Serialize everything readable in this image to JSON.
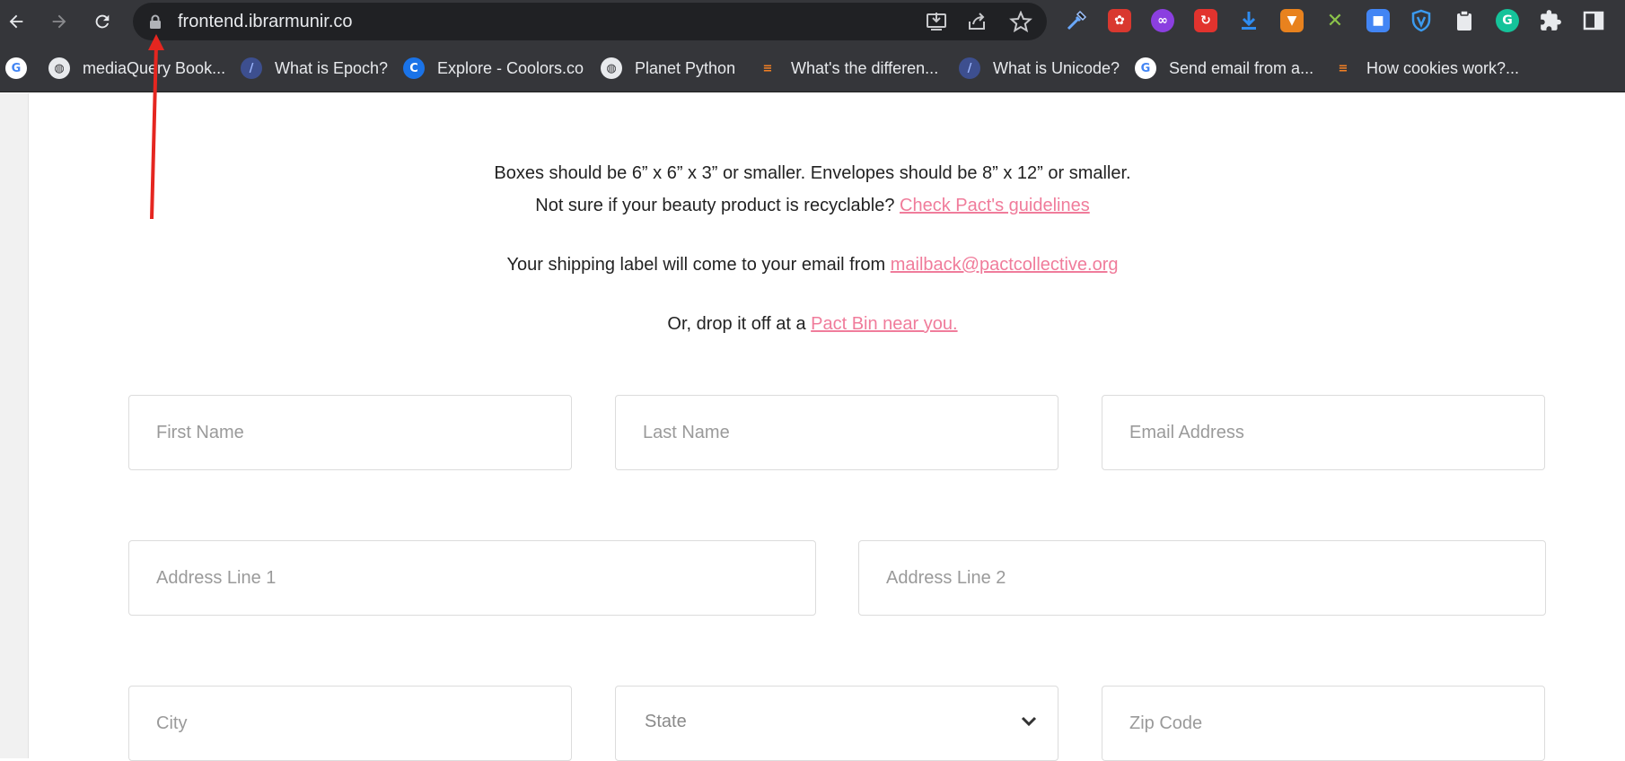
{
  "browser": {
    "url": "frontend.ibrarmunir.co",
    "bookmarks": [
      {
        "label": "",
        "icon": "google-icon"
      },
      {
        "label": "mediaQuery Book...",
        "icon": "globe-icon"
      },
      {
        "label": "What is Epoch?",
        "icon": "slash-icon"
      },
      {
        "label": "Explore - Coolors.co",
        "icon": "coolors-icon"
      },
      {
        "label": "Planet Python",
        "icon": "globe-icon"
      },
      {
        "label": "What's the differen...",
        "icon": "stackoverflow-icon"
      },
      {
        "label": "What is Unicode?",
        "icon": "slash-icon"
      },
      {
        "label": "Send email from a...",
        "icon": "google-icon"
      },
      {
        "label": "How cookies work?...",
        "icon": "stackoverflow-icon"
      }
    ]
  },
  "content": {
    "line1": "Boxes should be 6” x 6” x 3” or smaller. Envelopes should be 8” x 12” or smaller.",
    "line2_text": "Not sure if your beauty product is recyclable? ",
    "line2_link": "Check Pact's guidelines",
    "line3_text": "Your shipping label will come to your email from ",
    "line3_link": "mailback@pactcollective.org",
    "line4_text": "Or, drop it off at a ",
    "line4_link": "Pact Bin near you."
  },
  "form": {
    "first_name": "First Name",
    "last_name": "Last Name",
    "email": "Email Address",
    "address1": "Address Line 1",
    "address2": "Address Line 2",
    "city": "City",
    "state": "State",
    "zip": "Zip Code"
  },
  "colors": {
    "link": "#f07c9b",
    "annotation_arrow": "#e52620"
  }
}
